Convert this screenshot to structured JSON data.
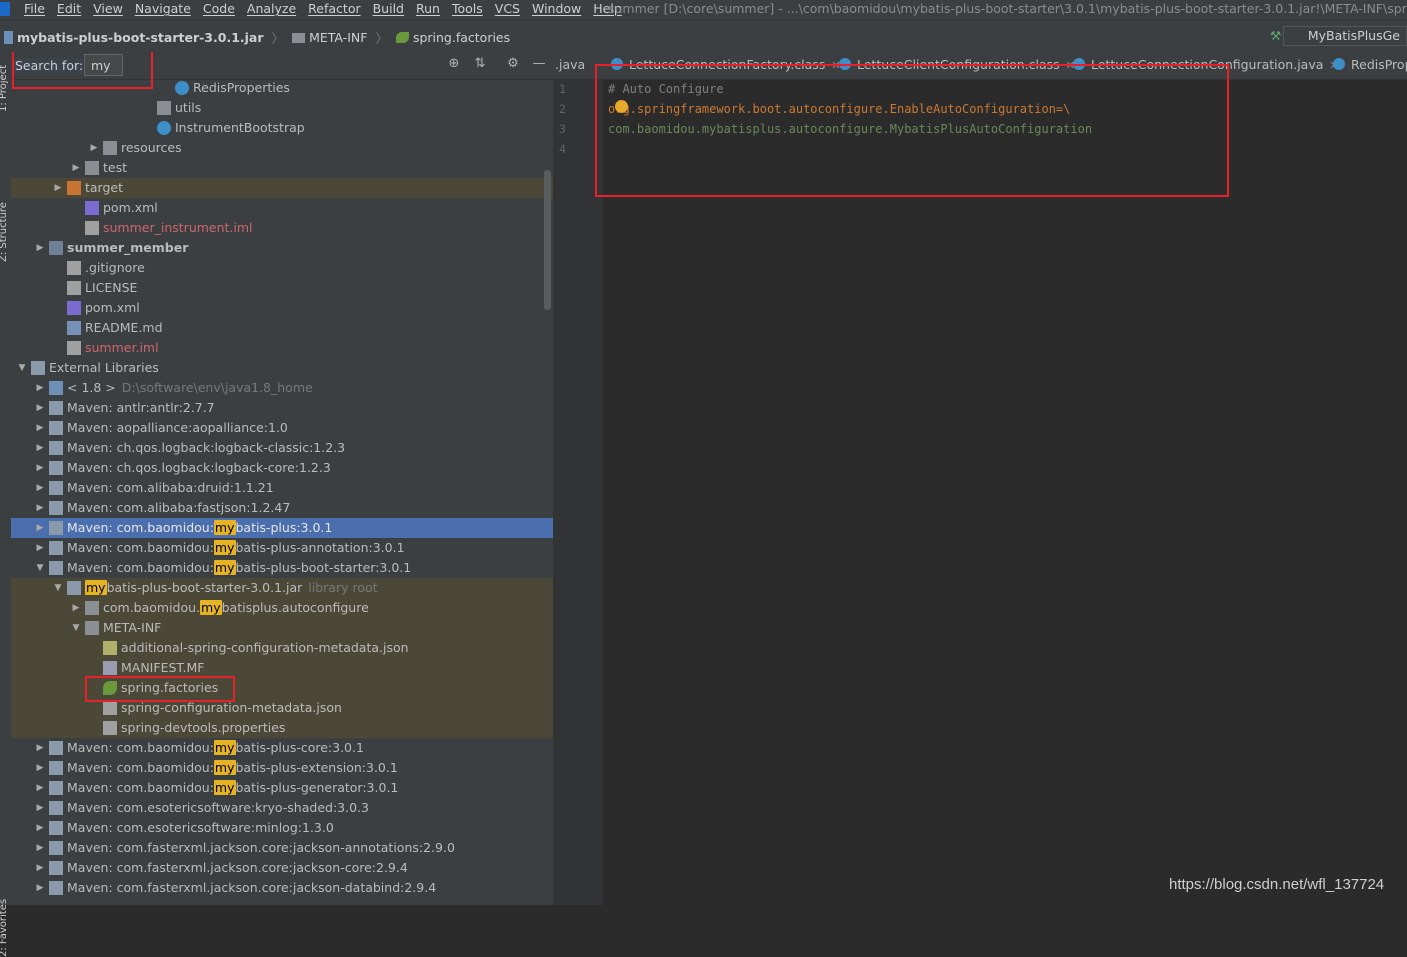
{
  "menu": {
    "items": [
      "File",
      "Edit",
      "View",
      "Navigate",
      "Code",
      "Analyze",
      "Refactor",
      "Build",
      "Run",
      "Tools",
      "VCS",
      "Window",
      "Help"
    ],
    "window_title": "summer [D:\\core\\summer] - ...\\com\\baomidou\\mybatis-plus-boot-starter\\3.0.1\\mybatis-plus-boot-starter-3.0.1.jar!\\META-INF\\spring.fact"
  },
  "breadcrumb": {
    "jar": "mybatis-plus-boot-starter-3.0.1.jar",
    "folder": "META-INF",
    "file": "spring.factories"
  },
  "run_config": "MyBatisPlusGe",
  "search": {
    "label": "Search for:",
    "value": "my"
  },
  "sidebar_tabs": {
    "project": "1: Project",
    "structure": "Z: Structure",
    "favorites": "2: Favorites"
  },
  "tree": [
    {
      "text": "RedisProperties",
      "icon": "class-icon"
    },
    {
      "text": "utils",
      "icon": "package-icon"
    },
    {
      "text": "InstrumentBootstrap",
      "icon": "run-class-icon"
    },
    {
      "text": "resources",
      "icon": "folder-icon"
    },
    {
      "text": "test",
      "icon": "folder-icon"
    },
    {
      "text": "target",
      "icon": "orange-folder-icon"
    },
    {
      "text": "pom.xml",
      "icon": "maven-icon"
    },
    {
      "text": "summer_instrument.iml",
      "icon": "file-icon"
    },
    {
      "text": "summer_member",
      "icon": "module-icon"
    },
    {
      "text": ".gitignore",
      "icon": "file-icon"
    },
    {
      "text": "LICENSE",
      "icon": "file-icon"
    },
    {
      "text": "pom.xml",
      "icon": "maven-icon"
    },
    {
      "text": "README.md",
      "icon": "markdown-icon"
    },
    {
      "text": "summer.iml",
      "icon": "file-icon"
    },
    {
      "text": "External Libraries",
      "icon": "library-icon"
    },
    {
      "text": "< 1.8 >",
      "extra": "D:\\software\\env\\java1.8_home",
      "icon": "jdk-icon"
    },
    {
      "text": "Maven: antlr:antlr:2.7.7",
      "icon": "library-icon"
    },
    {
      "text": "Maven: aopalliance:aopalliance:1.0",
      "icon": "library-icon"
    },
    {
      "text": "Maven: ch.qos.logback:logback-classic:1.2.3",
      "icon": "library-icon"
    },
    {
      "text": "Maven: ch.qos.logback:logback-core:1.2.3",
      "icon": "library-icon"
    },
    {
      "text": "Maven: com.alibaba:druid:1.1.21",
      "icon": "library-icon"
    },
    {
      "text": "Maven: com.alibaba:fastjson:1.2.47",
      "icon": "library-icon"
    },
    {
      "pre": "Maven: com.baomidou:",
      "hl": "my",
      "post": "batis-plus:3.0.1",
      "icon": "library-icon"
    },
    {
      "pre": "Maven: com.baomidou:",
      "hl": "my",
      "post": "batis-plus-annotation:3.0.1",
      "icon": "library-icon"
    },
    {
      "pre": "Maven: com.baomidou:",
      "hl": "my",
      "post": "batis-plus-boot-starter:3.0.1",
      "icon": "library-icon"
    },
    {
      "pre": "",
      "hl": "my",
      "post": "batis-plus-boot-starter-3.0.1.jar",
      "extra": "library root",
      "icon": "jar-icon"
    },
    {
      "pre": "com.baomidou.",
      "hl": "my",
      "post": "batisplus.autoconfigure",
      "icon": "package-icon"
    },
    {
      "text": "META-INF",
      "icon": "folder-icon"
    },
    {
      "text": "additional-spring-configuration-metadata.json",
      "icon": "json-icon"
    },
    {
      "text": "MANIFEST.MF",
      "icon": "manifest-icon"
    },
    {
      "text": "spring.factories",
      "icon": "spring-icon"
    },
    {
      "text": "spring-configuration-metadata.json",
      "icon": "file-icon"
    },
    {
      "text": "spring-devtools.properties",
      "icon": "file-icon"
    },
    {
      "pre": "Maven: com.baomidou:",
      "hl": "my",
      "post": "batis-plus-core:3.0.1",
      "icon": "library-icon"
    },
    {
      "pre": "Maven: com.baomidou:",
      "hl": "my",
      "post": "batis-plus-extension:3.0.1",
      "icon": "library-icon"
    },
    {
      "pre": "Maven: com.baomidou:",
      "hl": "my",
      "post": "batis-plus-generator:3.0.1",
      "icon": "library-icon"
    },
    {
      "text": "Maven: com.esotericsoftware:kryo-shaded:3.0.3",
      "icon": "library-icon"
    },
    {
      "text": "Maven: com.esotericsoftware:minlog:1.3.0",
      "icon": "library-icon"
    },
    {
      "text": "Maven: com.fasterxml.jackson.core:jackson-annotations:2.9.0",
      "icon": "library-icon"
    },
    {
      "text": "Maven: com.fasterxml.jackson.core:jackson-core:2.9.4",
      "icon": "library-icon"
    },
    {
      "text": "Maven: com.fasterxml.jackson.core:jackson-databind:2.9.4",
      "icon": "library-icon"
    }
  ],
  "tabs": [
    {
      "label": ".java",
      "icon": "java-icon"
    },
    {
      "label": "LettuceConnectionFactory.class",
      "icon": "class-icon"
    },
    {
      "label": "LettuceClientConfiguration.class",
      "icon": "class-icon"
    },
    {
      "label": "LettuceConnectionConfiguration.java",
      "icon": "class-icon"
    },
    {
      "label": "RedisProp",
      "icon": "class-icon"
    }
  ],
  "editor": {
    "line_numbers": [
      "1",
      "2",
      "3",
      "4"
    ],
    "lines": [
      "# Auto Configure",
      "org.springframework.boot.autoconfigure.EnableAutoConfiguration=\\",
      "com.baomidou.mybatisplus.autoconfigure.MybatisPlusAutoConfiguration",
      ""
    ],
    "colors": {
      "comment": "#808080",
      "key": "#cc7832",
      "value": "#6a8759"
    }
  },
  "watermark": "https://blog.csdn.net/wfl_137724",
  "colors": {
    "selection": "#4b6eaf",
    "library_root_bg": "#4c4838",
    "search_highlight": "#e6b422",
    "annotation_red": "#e8202a"
  }
}
